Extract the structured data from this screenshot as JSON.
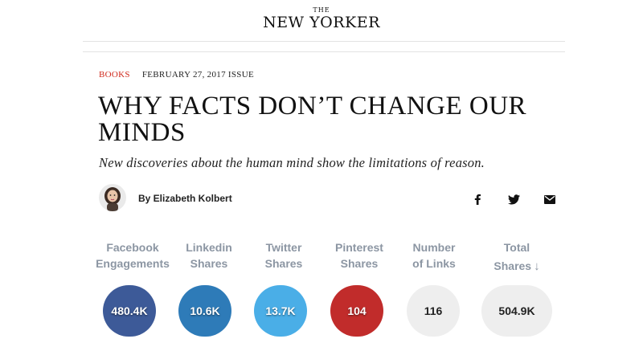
{
  "masthead": {
    "the": "THE",
    "name": "NEW YORKER"
  },
  "article": {
    "section": "BOOKS",
    "issue": "FEBRUARY 27, 2017 ISSUE",
    "headline": "WHY FACTS DON’T CHANGE OUR MINDS",
    "dek": "New discoveries about the human mind show the limitations of reason.",
    "byline": "By Elizabeth Kolbert"
  },
  "share_icons": [
    "facebook-icon",
    "twitter-icon",
    "email-icon"
  ],
  "stats": [
    {
      "label_line1": "Facebook",
      "label_line2": "Engagements",
      "value": "480.4K",
      "color": "#3d5a98"
    },
    {
      "label_line1": "Linkedin",
      "label_line2": "Shares",
      "value": "10.6K",
      "color": "#2e7bb8"
    },
    {
      "label_line1": "Twitter",
      "label_line2": "Shares",
      "value": "13.7K",
      "color": "#4aaee7"
    },
    {
      "label_line1": "Pinterest",
      "label_line2": "Shares",
      "value": "104",
      "color": "#c12c2b"
    },
    {
      "label_line1": "Number",
      "label_line2": "of Links",
      "value": "116",
      "color": "#eeeeee"
    },
    {
      "label_line1": "Total",
      "label_line2": "Shares",
      "sort_arrow": "↓",
      "value": "504.9K",
      "color": "#eeeeee"
    }
  ]
}
